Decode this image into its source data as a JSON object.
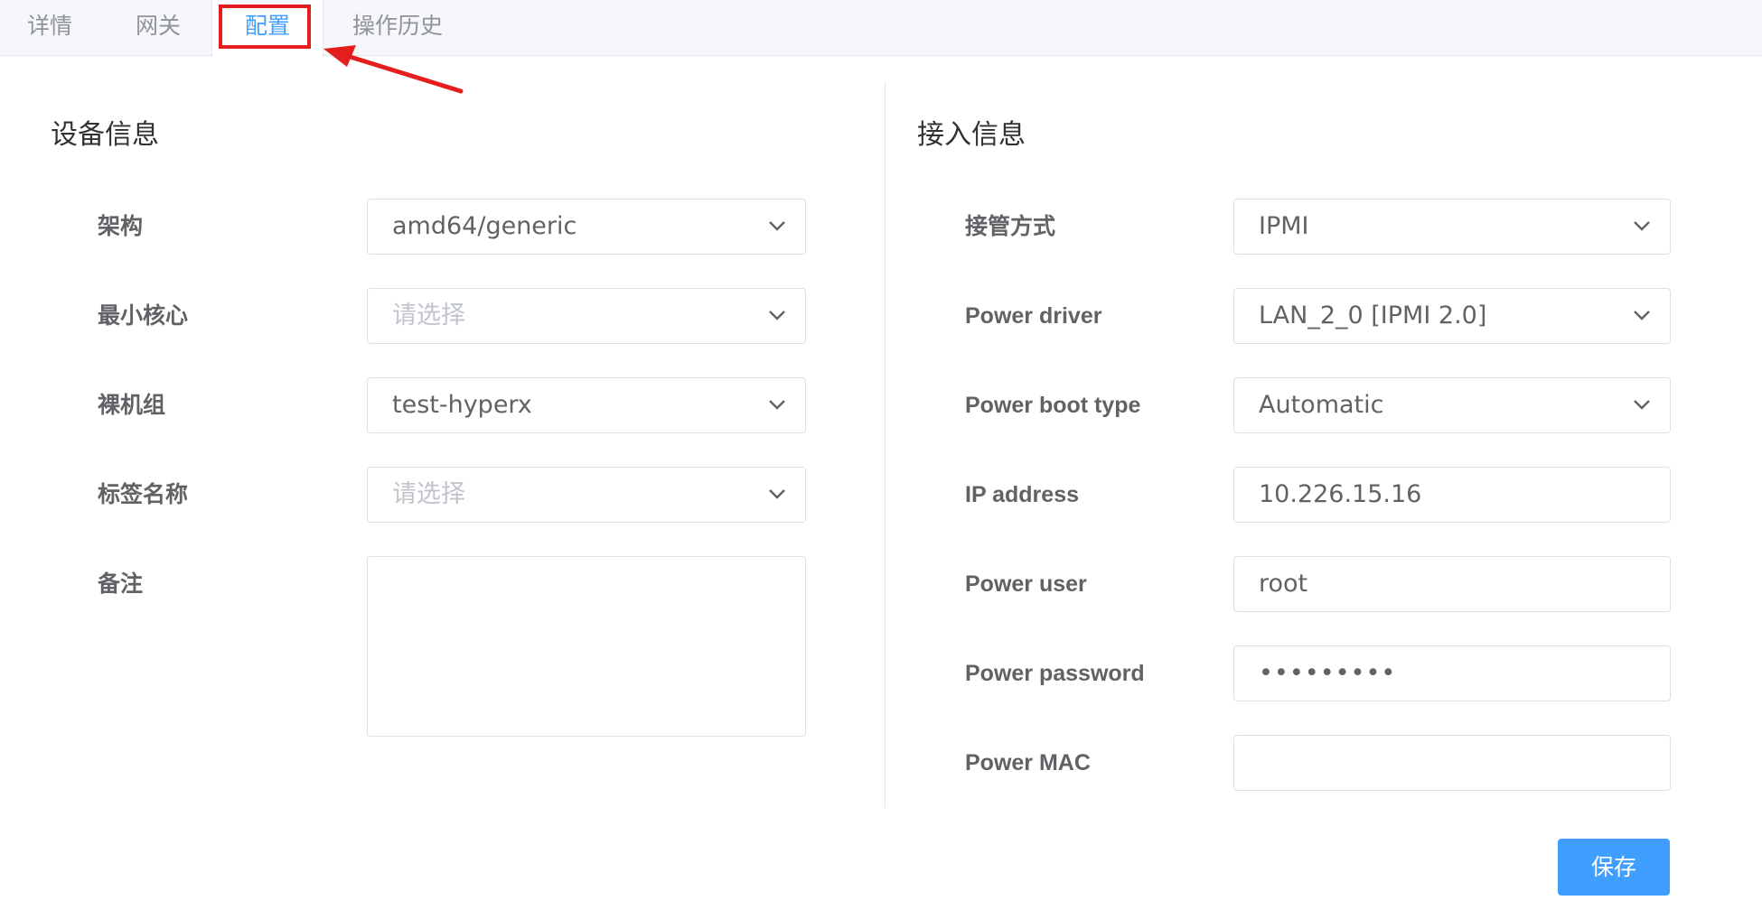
{
  "tabs": [
    "详情",
    "网关",
    "配置",
    "操作历史"
  ],
  "active_tab": "配置",
  "device_info": {
    "title": "设备信息",
    "fields": [
      {
        "label": "架构",
        "value": "amd64/generic",
        "placeholder": ""
      },
      {
        "label": "最小核心",
        "value": "",
        "placeholder": "请选择"
      },
      {
        "label": "裸机组",
        "value": "test-hyperx",
        "placeholder": ""
      },
      {
        "label": "标签名称",
        "value": "",
        "placeholder": "请选择"
      }
    ],
    "remark_label": "备注",
    "remark_value": ""
  },
  "access_info": {
    "title": "接入信息",
    "fields": [
      {
        "label": "接管方式",
        "value": "IPMI",
        "type": "select"
      },
      {
        "label": "Power driver",
        "value": "LAN_2_0 [IPMI 2.0]",
        "type": "select"
      },
      {
        "label": "Power boot type",
        "value": "Automatic",
        "type": "select"
      },
      {
        "label": "IP address",
        "value": "10.226.15.16",
        "type": "input"
      },
      {
        "label": "Power user",
        "value": "root",
        "type": "input"
      },
      {
        "label": "Power password",
        "value": "•••••••••",
        "type": "password"
      },
      {
        "label": "Power MAC",
        "value": "",
        "type": "input"
      }
    ]
  },
  "save_label": "保存",
  "icons": {
    "select_arrow": "chevron-down-icon",
    "annotation": "red-arrow-pointer"
  },
  "colors": {
    "accent": "#409eff",
    "annotation": "#e41e1e",
    "label": "#606266",
    "placeholder": "#c0c4cc"
  }
}
